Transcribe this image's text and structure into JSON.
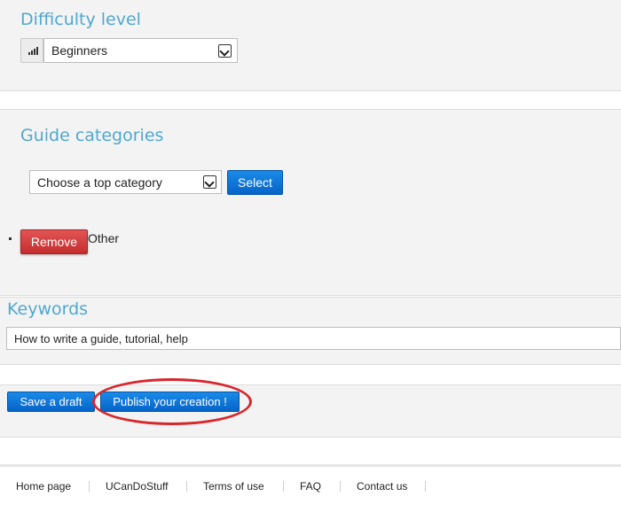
{
  "difficulty": {
    "title": "Difficulty level",
    "icon": "signal-bars-icon",
    "selected": "Beginners"
  },
  "categories": {
    "title": "Guide categories",
    "select_placeholder": "Choose a top category",
    "select_button": "Select",
    "items": [
      {
        "remove_label": "Remove",
        "name": "Other"
      }
    ]
  },
  "keywords": {
    "title": "Keywords",
    "value": "How to write a guide, tutorial, help"
  },
  "actions": {
    "save_draft": "Save a draft",
    "publish": "Publish your creation !",
    "highlight_color": "#d8262b"
  },
  "footer": {
    "links": [
      "Home page",
      "UCanDoStuff",
      "Terms of use",
      "FAQ",
      "Contact us"
    ]
  }
}
